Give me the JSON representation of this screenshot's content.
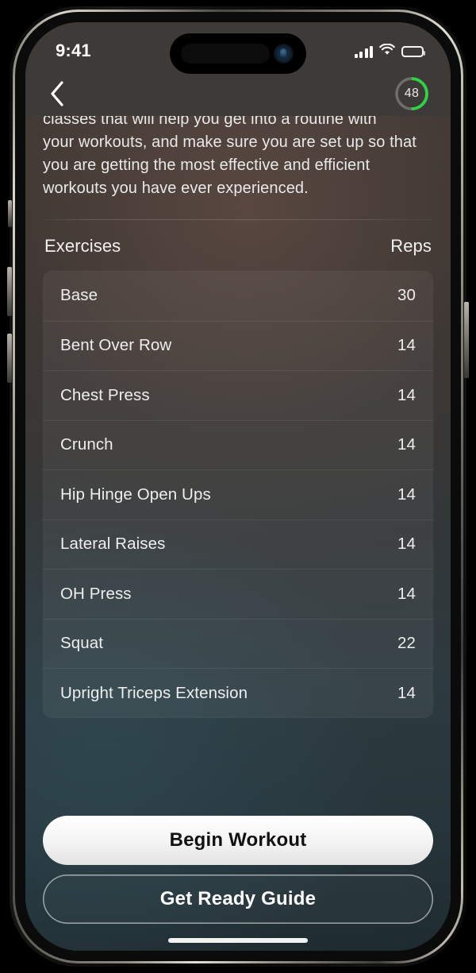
{
  "status_bar": {
    "time": "9:41",
    "cellular_icon": "cellular-bars-icon",
    "wifi_icon": "wifi-icon",
    "battery_icon": "battery-full-icon"
  },
  "header": {
    "back_icon": "chevron-left-icon",
    "progress_ring": {
      "value": "48",
      "percent": 50,
      "track_color": "#6e6e6e",
      "progress_color": "#2fd446"
    }
  },
  "intro": {
    "clipped_line": "classes that will help you get into a routine with",
    "body": "your workouts, and make sure you are set up so that you are getting the most effective and efficient workouts you have ever experienced."
  },
  "table": {
    "columns": [
      "Exercises",
      "Reps"
    ],
    "rows": [
      {
        "name": "Base",
        "reps": "30"
      },
      {
        "name": "Bent Over Row",
        "reps": "14"
      },
      {
        "name": "Chest Press",
        "reps": "14"
      },
      {
        "name": "Crunch",
        "reps": "14"
      },
      {
        "name": "Hip Hinge Open Ups",
        "reps": "14"
      },
      {
        "name": "Lateral Raises",
        "reps": "14"
      },
      {
        "name": "OH Press",
        "reps": "14"
      },
      {
        "name": "Squat",
        "reps": "22"
      },
      {
        "name": "Upright Triceps Extension",
        "reps": "14"
      }
    ]
  },
  "footer": {
    "primary_label": "Begin Workout",
    "secondary_label": "Get Ready Guide"
  }
}
